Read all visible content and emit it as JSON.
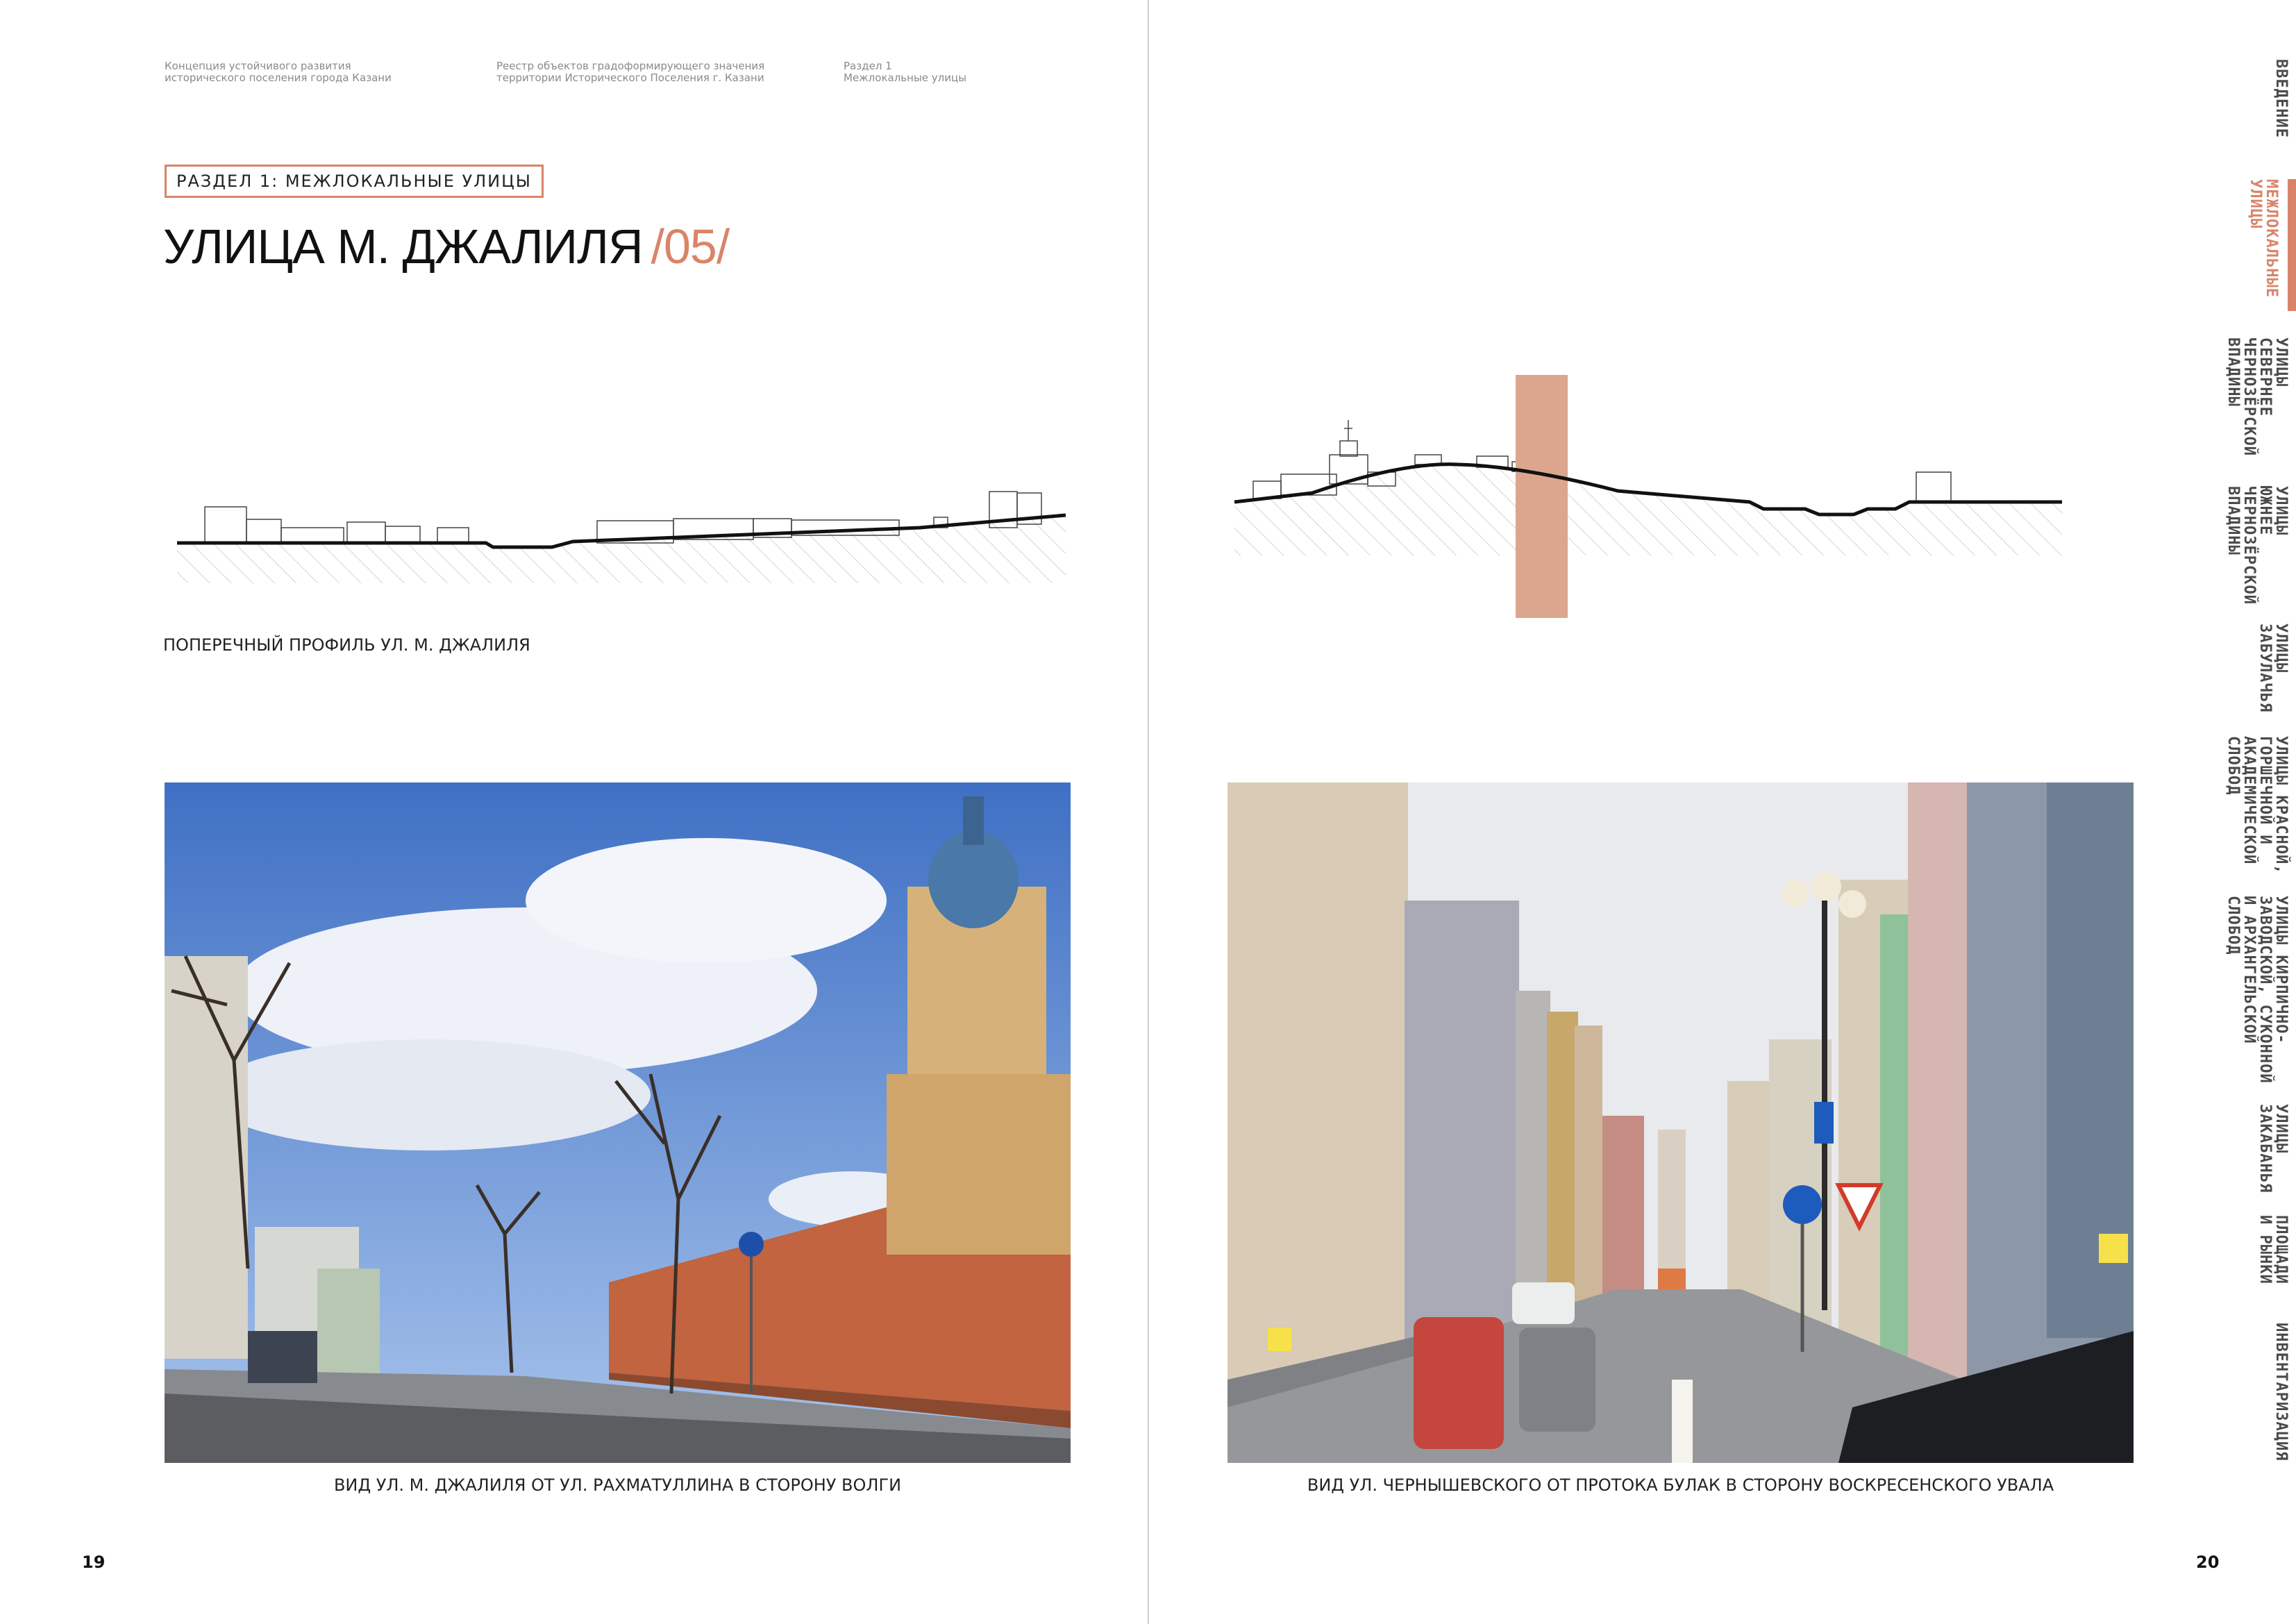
{
  "header": {
    "notes": [
      "Концепция устойчивого развития\nисторического поселения города Казани",
      "Реестр объектов градоформирующего значения\nтерритории Исторического Поселения г. Казани",
      "Раздел 1\nМежлокальные улицы"
    ]
  },
  "section_label": "РАЗДЕЛ 1: МЕЖЛОКАЛЬНЫЕ УЛИЦЫ",
  "title": {
    "text": "УЛИЦА М. ДЖАЛИЛЯ",
    "number": "/05/"
  },
  "profile": {
    "caption": "ПОПЕРЕЧНЫЙ ПРОФИЛЬ УЛ. М. ДЖАЛИЛЯ"
  },
  "photos": [
    {
      "caption": "ВИД УЛ. М. ДЖАЛИЛЯ ОТ УЛ. РАХМАТУЛЛИНА В СТОРОНУ ВОЛГИ"
    },
    {
      "caption": "ВИД УЛ. ЧЕРНЫШЕВСКОГО ОТ ПРОТОКА БУЛАК В СТОРОНУ ВОСКРЕСЕНСКОГО УВАЛА"
    }
  ],
  "pages": {
    "left": "19",
    "right": "20"
  },
  "nav": {
    "active_index": 1,
    "items": [
      "ВВЕДЕНИЕ",
      "МЕЖЛОКАЛЬНЫЕ\nУЛИЦЫ",
      "УЛИЦЫ\nСЕВЕРНЕЕ\nЧЕРНОЗЁРСКОЙ\nВПАДИНЫ",
      "УЛИЦЫ\nЮЖНЕЕ\nЧЕРНОЗЁРСКОЙ\nВПАДИНЫ",
      "УЛИЦЫ\nЗАБУЛАЧЬЯ",
      "УЛИЦЫ КРАСНОЙ,\nГОРШЕЧНОЙ И\nАКАДЕМИЧЕСКОЙ\nСЛОБОД",
      "УЛИЦЫ КИРПИЧНО-\nЗАВОДСКОЙ, СУКОННОЙ\nИ АРХАНГЕЛЬСКОЙ\nСЛОБОД",
      "УЛИЦЫ\nЗАКАБАНЬЯ",
      "ПЛОЩАДИ\nИ РЫНКИ",
      "ИНВЕНТАРИЗАЦИЯ"
    ]
  },
  "colors": {
    "accent": "#d9846a",
    "accent_fill": "#dba58e"
  }
}
